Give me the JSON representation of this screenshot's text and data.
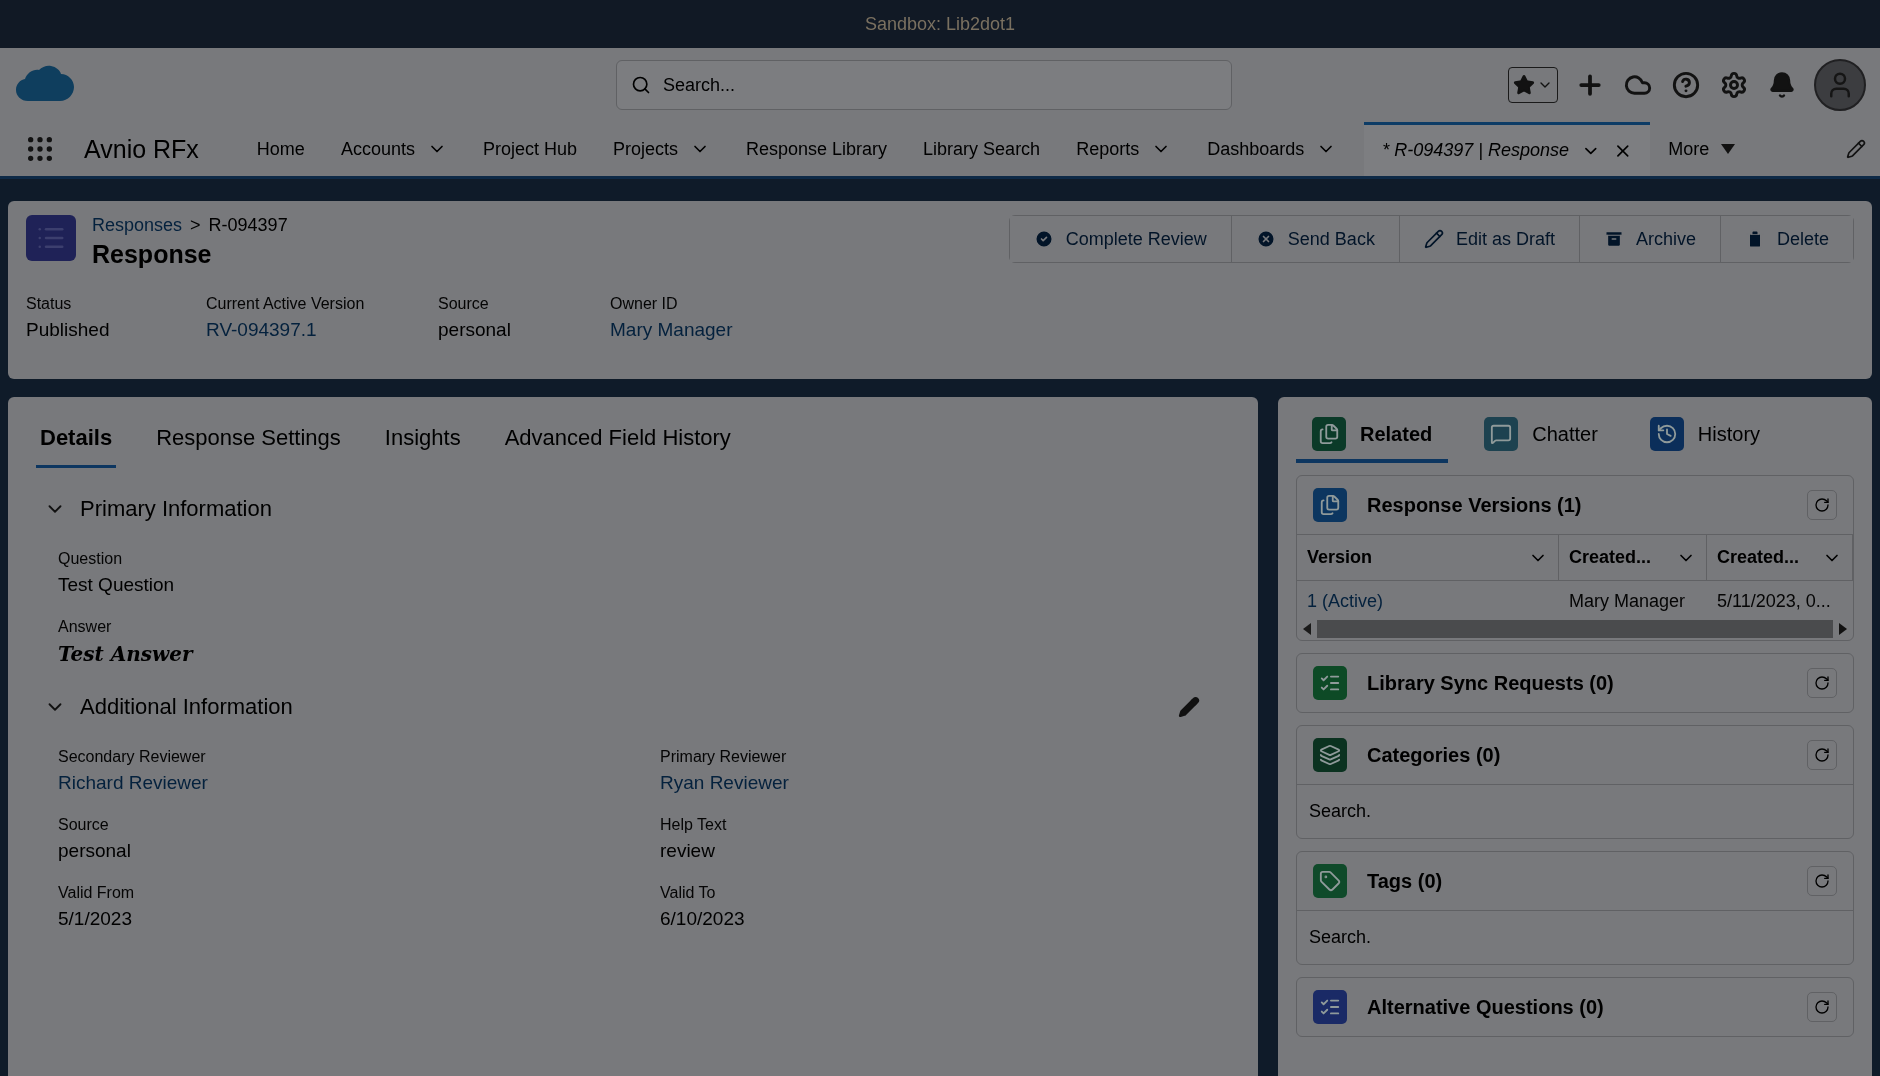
{
  "sandbox_title": "Sandbox: Lib2dot1",
  "search": {
    "placeholder": "Search..."
  },
  "app_name": "Avnio RFx",
  "nav_items": [
    {
      "kind": "link",
      "label": "Home",
      "has_menu": false
    },
    {
      "kind": "link",
      "label": "Accounts",
      "has_menu": true
    },
    {
      "kind": "link",
      "label": "Project Hub",
      "has_menu": false
    },
    {
      "kind": "link",
      "label": "Projects",
      "has_menu": true
    },
    {
      "kind": "link",
      "label": "Response Library",
      "has_menu": false
    },
    {
      "kind": "link",
      "label": "Library Search",
      "has_menu": false
    },
    {
      "kind": "link",
      "label": "Reports",
      "has_menu": true
    },
    {
      "kind": "link",
      "label": "Dashboards",
      "has_menu": true
    },
    {
      "kind": "record_tab",
      "label": "* R-094397 | Response",
      "has_menu": true,
      "selected": true
    },
    {
      "kind": "more",
      "label": "More",
      "has_menu": true
    }
  ],
  "record": {
    "breadcrumb": "Responses",
    "separator": ">",
    "record_id": "R-094397",
    "title": "Response",
    "actions": [
      "Complete Review",
      "Send Back",
      "Edit as Draft",
      "Archive",
      "Delete"
    ],
    "fields": [
      {
        "label": "Status",
        "value": "Published",
        "link": false
      },
      {
        "label": "Current Active Version",
        "value": "RV-094397.1",
        "link": true
      },
      {
        "label": "Source",
        "value": "personal",
        "link": false
      },
      {
        "label": "Owner ID",
        "value": "Mary Manager",
        "link": true
      }
    ]
  },
  "detail_tabs": [
    {
      "label": "Details",
      "selected": true
    },
    {
      "label": "Response Settings",
      "selected": false
    },
    {
      "label": "Insights",
      "selected": false
    },
    {
      "label": "Advanced Field History",
      "selected": false
    }
  ],
  "sections": [
    {
      "title": "Primary Information",
      "expanded": true,
      "editable": false,
      "two_column": false,
      "fields": [
        {
          "label": "Question",
          "value": "Test Question",
          "kind": "text"
        },
        {
          "label": "Answer",
          "value": "Test Answer",
          "kind": "rich"
        }
      ]
    },
    {
      "title": "Additional Information",
      "expanded": true,
      "editable": true,
      "two_column": true,
      "fields": [
        {
          "label": "Secondary Reviewer",
          "value": "Richard Reviewer",
          "kind": "link"
        },
        {
          "label": "Primary Reviewer",
          "value": "Ryan Reviewer",
          "kind": "link"
        },
        {
          "label": "Source",
          "value": "personal",
          "kind": "text"
        },
        {
          "label": "Help Text",
          "value": "review",
          "kind": "text"
        },
        {
          "label": "Valid From",
          "value": "5/1/2023",
          "kind": "text"
        },
        {
          "label": "Valid To",
          "value": "6/10/2023",
          "kind": "text"
        }
      ]
    }
  ],
  "related_tabs": [
    {
      "label": "Related",
      "selected": true,
      "color": "#0b3a28"
    },
    {
      "label": "Chatter",
      "selected": false,
      "color": "#1d4250"
    },
    {
      "label": "History",
      "selected": false,
      "color": "#0b2e5a"
    }
  ],
  "related_lists": [
    {
      "title": "Response Versions (1)",
      "color": "#0c3660",
      "table": {
        "columns": [
          "Version",
          "Created...",
          "Created..."
        ],
        "rows": [
          [
            {
              "text": "1 (Active)",
              "link": true
            },
            {
              "text": "Mary Manager",
              "link": false
            },
            {
              "text": "5/11/2023, 0...",
              "link": false
            }
          ]
        ]
      }
    },
    {
      "title": "Library Sync Requests (0)",
      "color": "#0d4a26"
    },
    {
      "title": "Categories (0)",
      "color": "#0b3220",
      "search": {
        "placeholder": "Search."
      }
    },
    {
      "title": "Tags (0)",
      "color": "#0f4a2a",
      "search": {
        "placeholder": "Search."
      }
    },
    {
      "title": "Alternative Questions (0)",
      "color": "#1a2a66"
    }
  ]
}
